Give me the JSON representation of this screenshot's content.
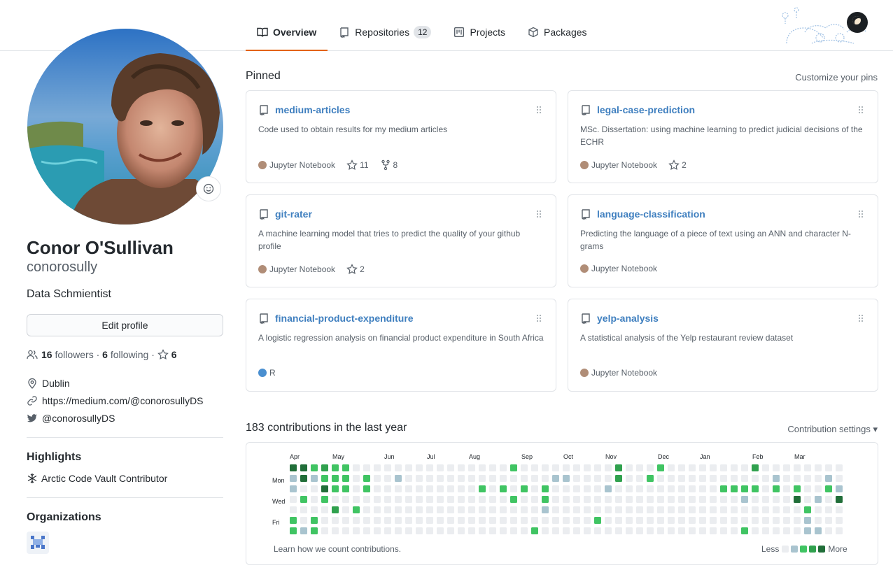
{
  "nav": {
    "tabs": [
      {
        "label": "Overview",
        "active": true,
        "icon": "book-icon"
      },
      {
        "label": "Repositories",
        "count": "12",
        "icon": "repo-icon"
      },
      {
        "label": "Projects",
        "icon": "project-icon"
      },
      {
        "label": "Packages",
        "icon": "package-icon"
      }
    ]
  },
  "profile": {
    "full_name": "Conor O'Sullivan",
    "username": "conorosully",
    "bio": "Data Schmientist",
    "edit_label": "Edit profile",
    "followers_count": "16",
    "followers_label": "followers",
    "following_count": "6",
    "following_label": "following",
    "stars_count": "6",
    "location": "Dublin",
    "website": "https://medium.com/@conorosullyDS",
    "twitter": "@conorosullyDS"
  },
  "highlights": {
    "title": "Highlights",
    "item": "Arctic Code Vault Contributor"
  },
  "organizations": {
    "title": "Organizations"
  },
  "pinned": {
    "title": "Pinned",
    "customize_label": "Customize your pins",
    "repos": [
      {
        "name": "medium-articles",
        "desc": "Code used to obtain results for my medium articles",
        "lang": "Jupyter Notebook",
        "lang_color": "#b08d77",
        "stars": "11",
        "forks": "8"
      },
      {
        "name": "legal-case-prediction",
        "desc": "MSc. Dissertation: using machine learning to predict judicial decisions of the ECHR",
        "lang": "Jupyter Notebook",
        "lang_color": "#b08d77",
        "stars": "2",
        "forks": ""
      },
      {
        "name": "git-rater",
        "desc": "A machine learning model that tries to predict the quality of your github profile",
        "lang": "Jupyter Notebook",
        "lang_color": "#b08d77",
        "stars": "2",
        "forks": ""
      },
      {
        "name": "language-classification",
        "desc": "Predicting the language of a piece of text using an ANN and character N-grams",
        "lang": "Jupyter Notebook",
        "lang_color": "#b08d77",
        "stars": "",
        "forks": ""
      },
      {
        "name": "financial-product-expenditure",
        "desc": "A logistic regression analysis on financial product expenditure in South Africa",
        "lang": "R",
        "lang_color": "#4a8fd0",
        "stars": "",
        "forks": ""
      },
      {
        "name": "yelp-analysis",
        "desc": "A statistical analysis of the Yelp restaurant review dataset",
        "lang": "Jupyter Notebook",
        "lang_color": "#b08d77",
        "stars": "",
        "forks": ""
      }
    ]
  },
  "contributions": {
    "title": "183 contributions in the last year",
    "settings_label": "Contribution settings ▾",
    "months": [
      "Apr",
      "May",
      "Jun",
      "Jul",
      "Aug",
      "Sep",
      "Oct",
      "Nov",
      "Dec",
      "Jan",
      "Feb",
      "Mar"
    ],
    "day_labels": [
      "Mon",
      "Wed",
      "Fri"
    ],
    "learn_label": "Learn how we count contributions.",
    "less_label": "Less",
    "more_label": "More",
    "colors": [
      "#ebedf0",
      "#a9c4cf",
      "#40c463",
      "#30a14e",
      "#216e39"
    ]
  }
}
